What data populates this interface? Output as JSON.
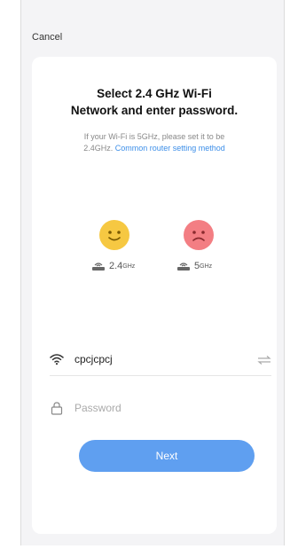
{
  "header": {
    "cancel_label": "Cancel"
  },
  "title_line1": "Select 2.4 GHz Wi-Fi",
  "title_line2": "Network and enter password.",
  "subtitle_line1": "If your Wi-Fi is 5GHz, please set it to be",
  "subtitle_prefix": "2.4GHz. ",
  "subtitle_link": "Common router setting method",
  "bands": [
    {
      "main": "2.4",
      "unit": "GHz",
      "status": "supported"
    },
    {
      "main": "5",
      "unit": "GHz",
      "status": "unsupported"
    }
  ],
  "wifi": {
    "ssid": "cpcjcpcj"
  },
  "password": {
    "placeholder": "Password",
    "value": ""
  },
  "next_label": "Next",
  "colors": {
    "accent": "#5f9ff0",
    "link": "#3c8ee8",
    "happy": "#f6c842",
    "sad": "#f37e83"
  }
}
